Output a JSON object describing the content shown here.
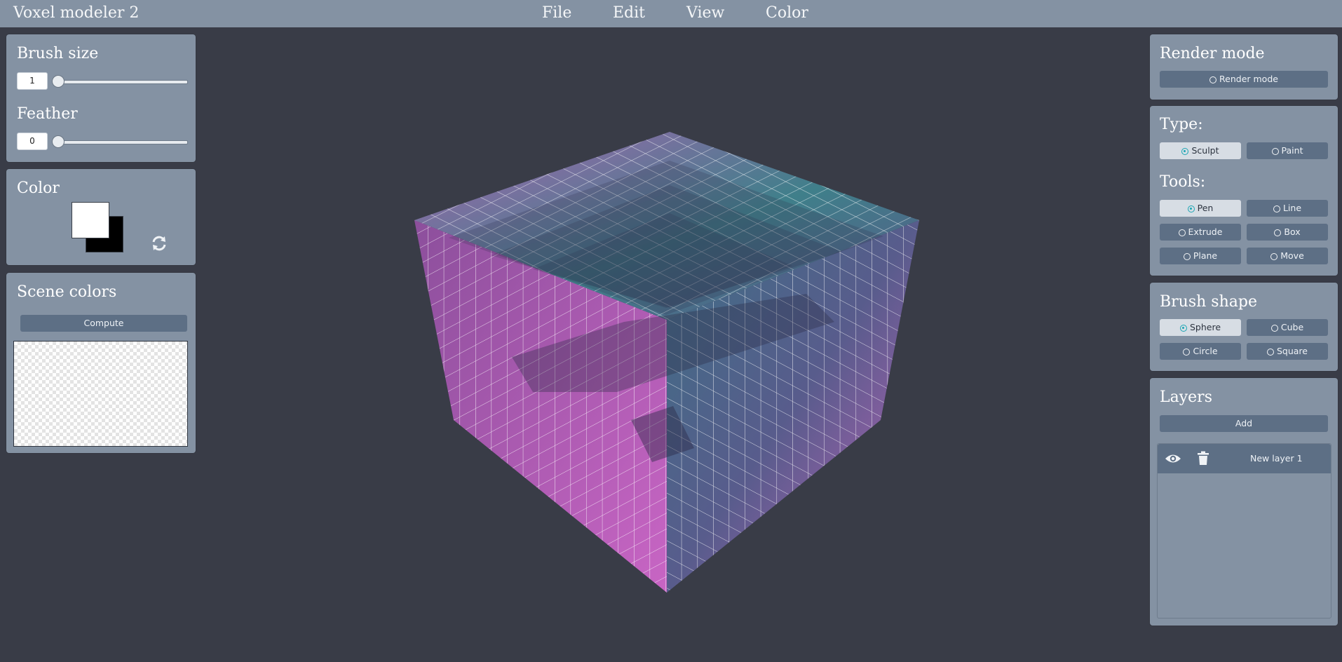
{
  "app": {
    "title": "Voxel modeler 2"
  },
  "menu": [
    {
      "label": "File"
    },
    {
      "label": "Edit"
    },
    {
      "label": "View"
    },
    {
      "label": "Color"
    }
  ],
  "brush": {
    "size_label": "Brush size",
    "size_value": "1",
    "feather_label": "Feather",
    "feather_value": "0"
  },
  "color_panel": {
    "title": "Color",
    "primary_color": "#ffffff",
    "secondary_color": "#000000",
    "swap_icon": "swap-icon"
  },
  "scene_colors": {
    "title": "Scene colors",
    "compute_label": "Compute"
  },
  "render": {
    "title": "Render mode",
    "button_label": "Render mode"
  },
  "type": {
    "title": "Type:",
    "options": [
      {
        "label": "Sculpt",
        "selected": true
      },
      {
        "label": "Paint",
        "selected": false
      }
    ]
  },
  "tools": {
    "title": "Tools:",
    "options": [
      {
        "label": "Pen",
        "selected": true
      },
      {
        "label": "Line",
        "selected": false
      },
      {
        "label": "Extrude",
        "selected": false
      },
      {
        "label": "Box",
        "selected": false
      },
      {
        "label": "Plane",
        "selected": false
      },
      {
        "label": "Move",
        "selected": false
      }
    ]
  },
  "brush_shape": {
    "title": "Brush shape",
    "options": [
      {
        "label": "Sphere",
        "selected": true
      },
      {
        "label": "Cube",
        "selected": false
      },
      {
        "label": "Circle",
        "selected": false
      },
      {
        "label": "Square",
        "selected": false
      }
    ]
  },
  "layers": {
    "title": "Layers",
    "add_label": "Add",
    "items": [
      {
        "name": "New layer 1",
        "visible_icon": "eye-icon",
        "delete_icon": "trash-icon"
      }
    ]
  },
  "colors": {
    "background": "#393c47",
    "panel": "#8492a3",
    "button": "#5d6f85",
    "button_active": "#d7dde4",
    "accent": "#1ca6b4",
    "voxel_pink": "#b556b8",
    "voxel_teal": "#3f7a86",
    "voxel_purple": "#5b5486"
  }
}
